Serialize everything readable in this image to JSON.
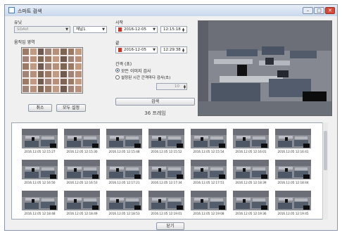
{
  "window": {
    "title": "스마트 검색",
    "min_btn": "–",
    "max_btn": "□",
    "close_btn": "✕"
  },
  "left": {
    "unit_label": "유닛",
    "unit_value": "SDAVI",
    "channel_value": "채널1",
    "area_label": "움직임 영역",
    "cancel_label": "취소",
    "select_all_label": "모두 설정"
  },
  "mid": {
    "start_label": "시작",
    "start_date": "2016-12-05",
    "start_time": "12:15:18",
    "end_label": "끝",
    "end_date": "2016-12-05",
    "end_time": "12:29:38",
    "interval_label": "간격 (초)",
    "option_all_label": "모든 이미지 검사",
    "option_interval_label": "설정된 시간 간격마다 검사(초)",
    "interval_value": "10",
    "search_button_label": "검색",
    "frame_count": "36 프레임"
  },
  "results": {
    "thumbnails": [
      {
        "timestamp": "2016.12.05 12:15:27"
      },
      {
        "timestamp": "2016.12.05 12:15:30"
      },
      {
        "timestamp": "2016.12.05 12:15:48"
      },
      {
        "timestamp": "2016.12.05 12:15:52"
      },
      {
        "timestamp": "2016.12.05 12:15:54"
      },
      {
        "timestamp": "2016.12.05 12:16:01"
      },
      {
        "timestamp": "2016.12.05 12:16:41"
      },
      {
        "timestamp": "2016.12.05 12:16:50"
      },
      {
        "timestamp": "2016.12.05 12:16:53"
      },
      {
        "timestamp": "2016.12.05 12:17:21"
      },
      {
        "timestamp": "2016.12.05 12:17:34"
      },
      {
        "timestamp": "2016.12.05 12:17:51"
      },
      {
        "timestamp": "2016.12.05 12:18:39"
      },
      {
        "timestamp": "2016.12.05 12:18:44"
      },
      {
        "timestamp": "2016.12.05 12:18:48"
      },
      {
        "timestamp": "2016.12.05 12:18:49"
      },
      {
        "timestamp": "2016.12.05 12:18:53"
      },
      {
        "timestamp": "2016.12.05 12:19:01"
      },
      {
        "timestamp": "2016.12.05 12:19:08"
      },
      {
        "timestamp": "2016.12.05 12:19:36"
      },
      {
        "timestamp": "2016.12.05 12:19:45"
      }
    ]
  },
  "footer": {
    "close_label": "닫기"
  }
}
